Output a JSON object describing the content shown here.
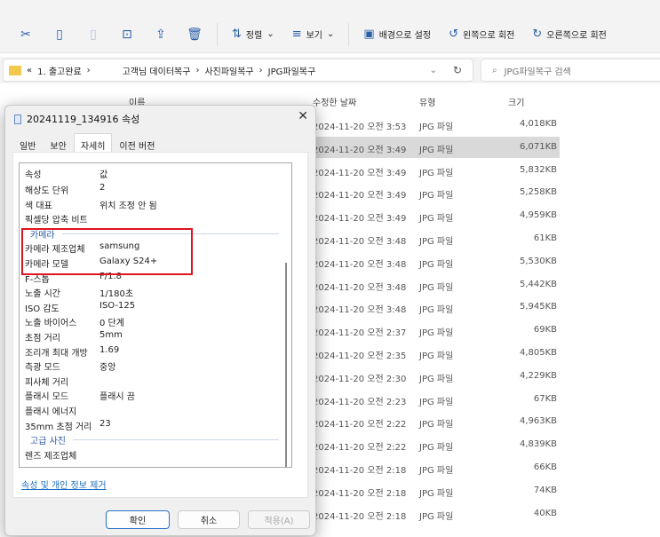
{
  "toolbar": {
    "sort": "정렬",
    "view": "보기",
    "set_background": "배경으로 설정",
    "rotate_left": "왼쪽으로 회전",
    "rotate_right": "오른쪽으로 회전"
  },
  "address": {
    "prefix": "«",
    "crumbs": [
      "1. 출고완료",
      "고객님 데이터복구",
      "사진파일복구",
      "JPG파일복구"
    ],
    "search_placeholder": "JPG파일복구 검색"
  },
  "columns": {
    "name": "이름",
    "modified": "수정한 날짜",
    "type": "유형",
    "size": "크기"
  },
  "files": [
    {
      "date": "2024-11-20 오전 3:53",
      "type": "JPG 파일",
      "size": "4,018KB"
    },
    {
      "date": "2024-11-20 오전 3:49",
      "type": "JPG 파일",
      "size": "6,071KB",
      "selected": true
    },
    {
      "date": "2024-11-20 오전 3:49",
      "type": "JPG 파일",
      "size": "5,832KB"
    },
    {
      "date": "2024-11-20 오전 3:49",
      "type": "JPG 파일",
      "size": "5,258KB"
    },
    {
      "date": "2024-11-20 오전 3:49",
      "type": "JPG 파일",
      "size": "4,959KB"
    },
    {
      "date": "2024-11-20 오전 3:48",
      "type": "JPG 파일",
      "size": "61KB"
    },
    {
      "date": "2024-11-20 오전 3:48",
      "type": "JPG 파일",
      "size": "5,530KB"
    },
    {
      "date": "2024-11-20 오전 3:48",
      "type": "JPG 파일",
      "size": "5,442KB"
    },
    {
      "date": "2024-11-20 오전 3:48",
      "type": "JPG 파일",
      "size": "5,945KB"
    },
    {
      "date": "2024-11-20 오전 2:37",
      "type": "JPG 파일",
      "size": "69KB"
    },
    {
      "date": "2024-11-20 오전 2:35",
      "type": "JPG 파일",
      "size": "4,805KB"
    },
    {
      "date": "2024-11-20 오전 2:30",
      "type": "JPG 파일",
      "size": "4,229KB"
    },
    {
      "date": "2024-11-20 오전 2:23",
      "type": "JPG 파일",
      "size": "67KB"
    },
    {
      "date": "2024-11-20 오전 2:22",
      "type": "JPG 파일",
      "size": "4,963KB"
    },
    {
      "date": "2024-11-20 오전 2:22",
      "type": "JPG 파일",
      "size": "4,839KB"
    },
    {
      "date": "2024-11-20 오전 2:18",
      "type": "JPG 파일",
      "size": "66KB"
    },
    {
      "date": "2024-11-20 오전 2:18",
      "type": "JPG 파일",
      "size": "74KB"
    },
    {
      "date": "2024-11-20 오전 2:18",
      "type": "JPG 파일",
      "size": "40KB"
    }
  ],
  "dialog": {
    "title": "20241119_134916 속성",
    "tabs": [
      "일반",
      "보안",
      "자세히",
      "이전 버전"
    ],
    "header": {
      "property": "속성",
      "value": "값"
    },
    "items": [
      {
        "k": "해상도 단위",
        "v": "2"
      },
      {
        "k": "색 대표",
        "v": "위치 조정 안 됨"
      },
      {
        "k": "픽셀당 압축 비트",
        "v": ""
      },
      {
        "group": "카메라"
      },
      {
        "k": "카메라 제조업체",
        "v": "samsung"
      },
      {
        "k": "카메라 모델",
        "v": "Galaxy S24+"
      },
      {
        "k": "F-스톱",
        "v": "F/1.8"
      },
      {
        "k": "노출 시간",
        "v": "1/180초"
      },
      {
        "k": "ISO 감도",
        "v": "ISO-125"
      },
      {
        "k": "노출 바이어스",
        "v": "0 단계"
      },
      {
        "k": "초점 거리",
        "v": "5mm"
      },
      {
        "k": "조리개 최대 개방",
        "v": "1.69"
      },
      {
        "k": "측광 모드",
        "v": "중앙"
      },
      {
        "k": "피사체 거리",
        "v": ""
      },
      {
        "k": "플래시 모드",
        "v": "플래시 끔"
      },
      {
        "k": "플래시 에너지",
        "v": ""
      },
      {
        "k": "35mm 초점 거리",
        "v": "23"
      },
      {
        "group": "고급 사진"
      },
      {
        "k": "렌즈 제조업체",
        "v": ""
      }
    ],
    "remove_link": "속성 및 개인 정보 제거",
    "ok": "확인",
    "cancel": "취소",
    "apply": "적용(A)"
  }
}
